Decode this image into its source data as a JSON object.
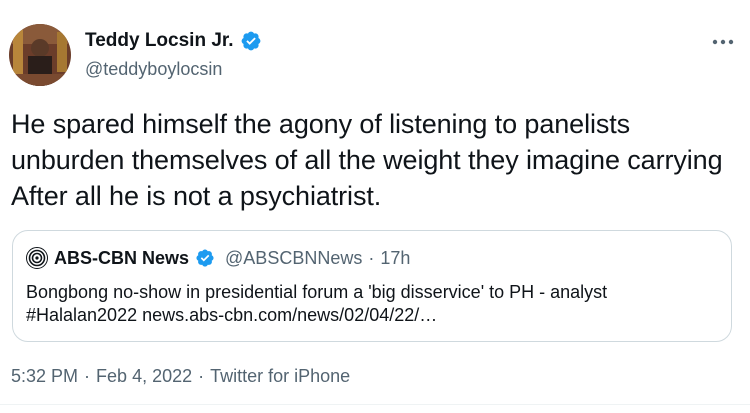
{
  "author": {
    "name": "Teddy Locsin Jr.",
    "handle": "@teddyboylocsin",
    "verified": true
  },
  "tweet": {
    "text": "He spared himself the agony of listening to panelists unburden themselves of all the weight they imagine carrying After all he is not a psychiatrist."
  },
  "quoted": {
    "name": "ABS-CBN News",
    "verified": true,
    "handle": "@ABSCBNNews",
    "separator": "·",
    "time": "17h",
    "text_line1": "Bongbong no-show in presidential forum a 'big disservice' to PH - analyst",
    "text_line2": "#Halalan2022 news.abs-cbn.com/news/02/04/22/…"
  },
  "meta": {
    "time": "5:32 PM",
    "sep1": "·",
    "date": "Feb 4, 2022",
    "sep2": "·",
    "source": "Twitter for iPhone"
  },
  "colors": {
    "verified_blue": "#1d9bf0",
    "text_primary": "#0f1419",
    "text_secondary": "#536471",
    "border": "#cfd9de"
  },
  "icons": {
    "more": "more-icon",
    "verified": "verified-badge-icon",
    "abs_logo": "abs-cbn-logo-icon"
  }
}
